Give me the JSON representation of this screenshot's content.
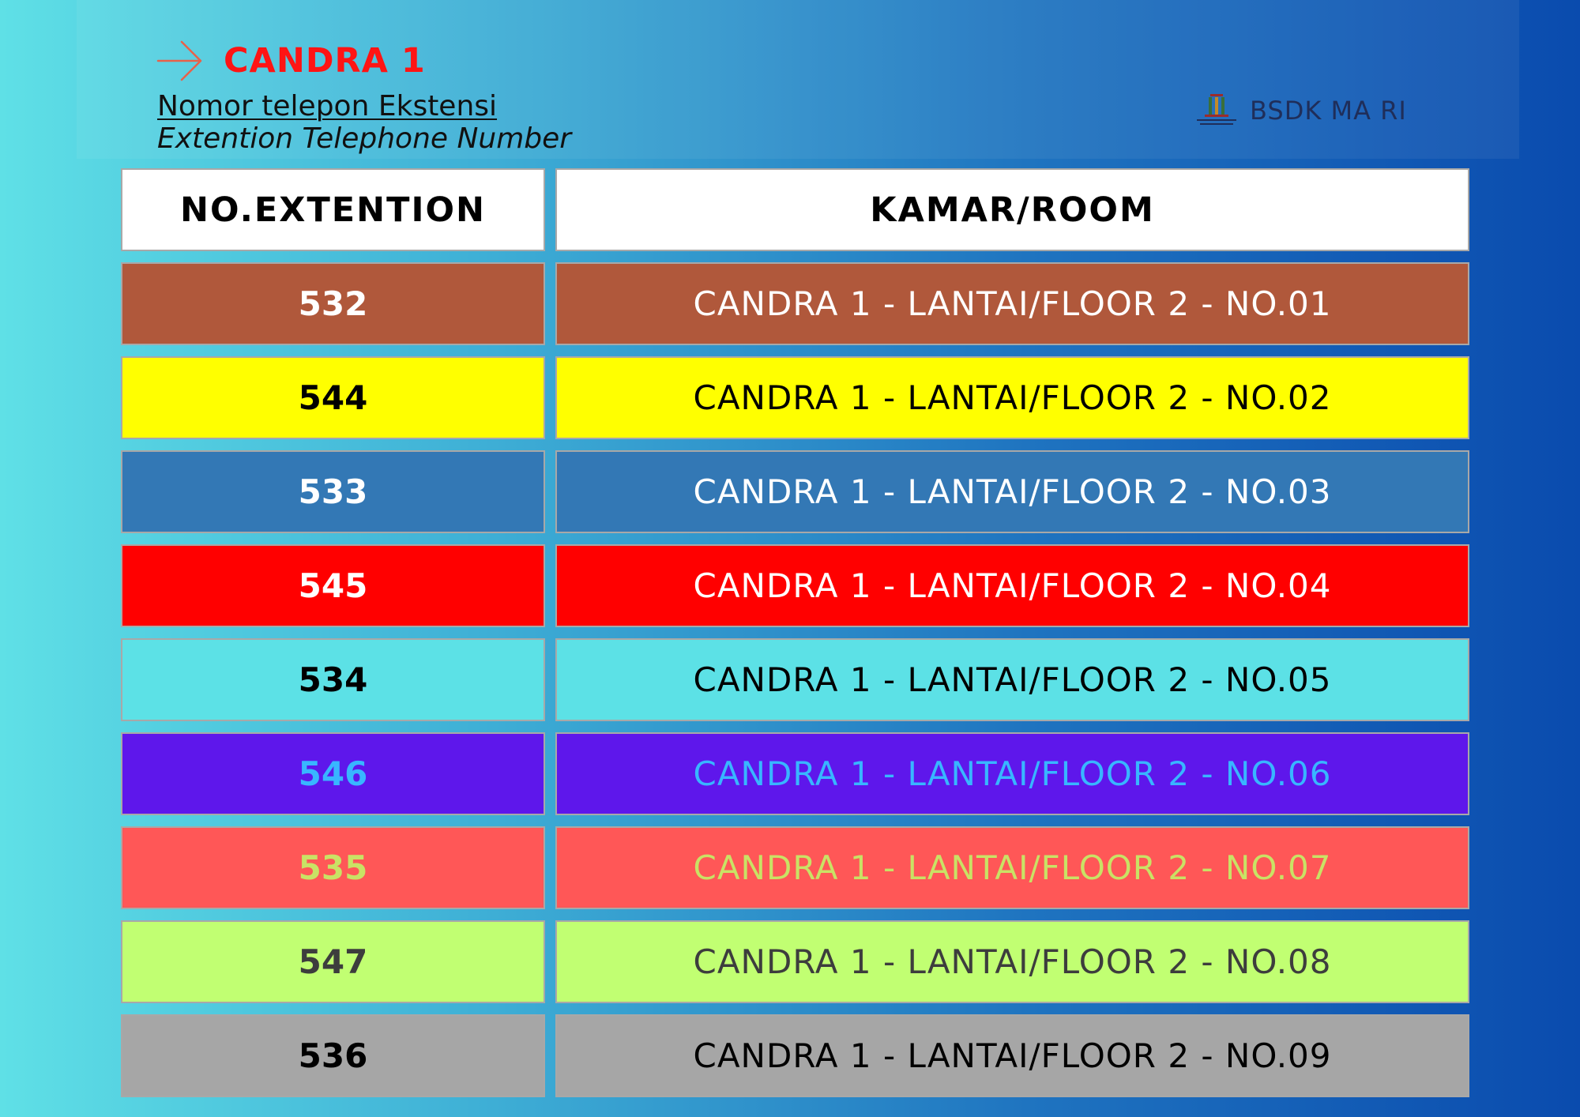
{
  "header": {
    "title": "CANDRA 1",
    "subtitle_id": "Nomor telepon Ekstensi",
    "subtitle_en": "Extention Telephone Number",
    "brand": "BSDK MA RI",
    "arrow_icon": "arrow-right-icon",
    "logo_icon": "building-logo-icon"
  },
  "table": {
    "columns": [
      "NO.EXTENTION",
      "KAMAR/ROOM"
    ],
    "rows": [
      {
        "ext": "532",
        "room": "CANDRA 1 - LANTAI/FLOOR 2 - NO.01",
        "bg": "#b0583b",
        "fg": "#ffffff"
      },
      {
        "ext": "544",
        "room": "CANDRA 1 - LANTAI/FLOOR 2 - NO.02",
        "bg": "#ffff00",
        "fg": "#000000"
      },
      {
        "ext": "533",
        "room": "CANDRA 1 - LANTAI/FLOOR 2 - NO.03",
        "bg": "#3378b5",
        "fg": "#ffffff"
      },
      {
        "ext": "545",
        "room": "CANDRA 1 - LANTAI/FLOOR 2 - NO.04",
        "bg": "#ff0000",
        "fg": "#ffffff"
      },
      {
        "ext": "534",
        "room": "CANDRA 1 - LANTAI/FLOOR 2 - NO.05",
        "bg": "#5ce1e6",
        "fg": "#000000"
      },
      {
        "ext": "546",
        "room": "CANDRA 1 - LANTAI/FLOOR 2 - NO.06",
        "bg": "#5e17eb",
        "fg": "#38b6ff"
      },
      {
        "ext": "535",
        "room": "CANDRA 1 - LANTAI/FLOOR 2 - NO.07",
        "bg": "#ff5757",
        "fg": "#c9e265"
      },
      {
        "ext": "547",
        "room": "CANDRA 1 - LANTAI/FLOOR 2 - NO.08",
        "bg": "#c1ff72",
        "fg": "#3d3d3d"
      },
      {
        "ext": "536",
        "room": "CANDRA 1 - LANTAI/FLOOR 2 - NO.09",
        "bg": "#a6a6a6",
        "fg": "#000000"
      }
    ]
  }
}
